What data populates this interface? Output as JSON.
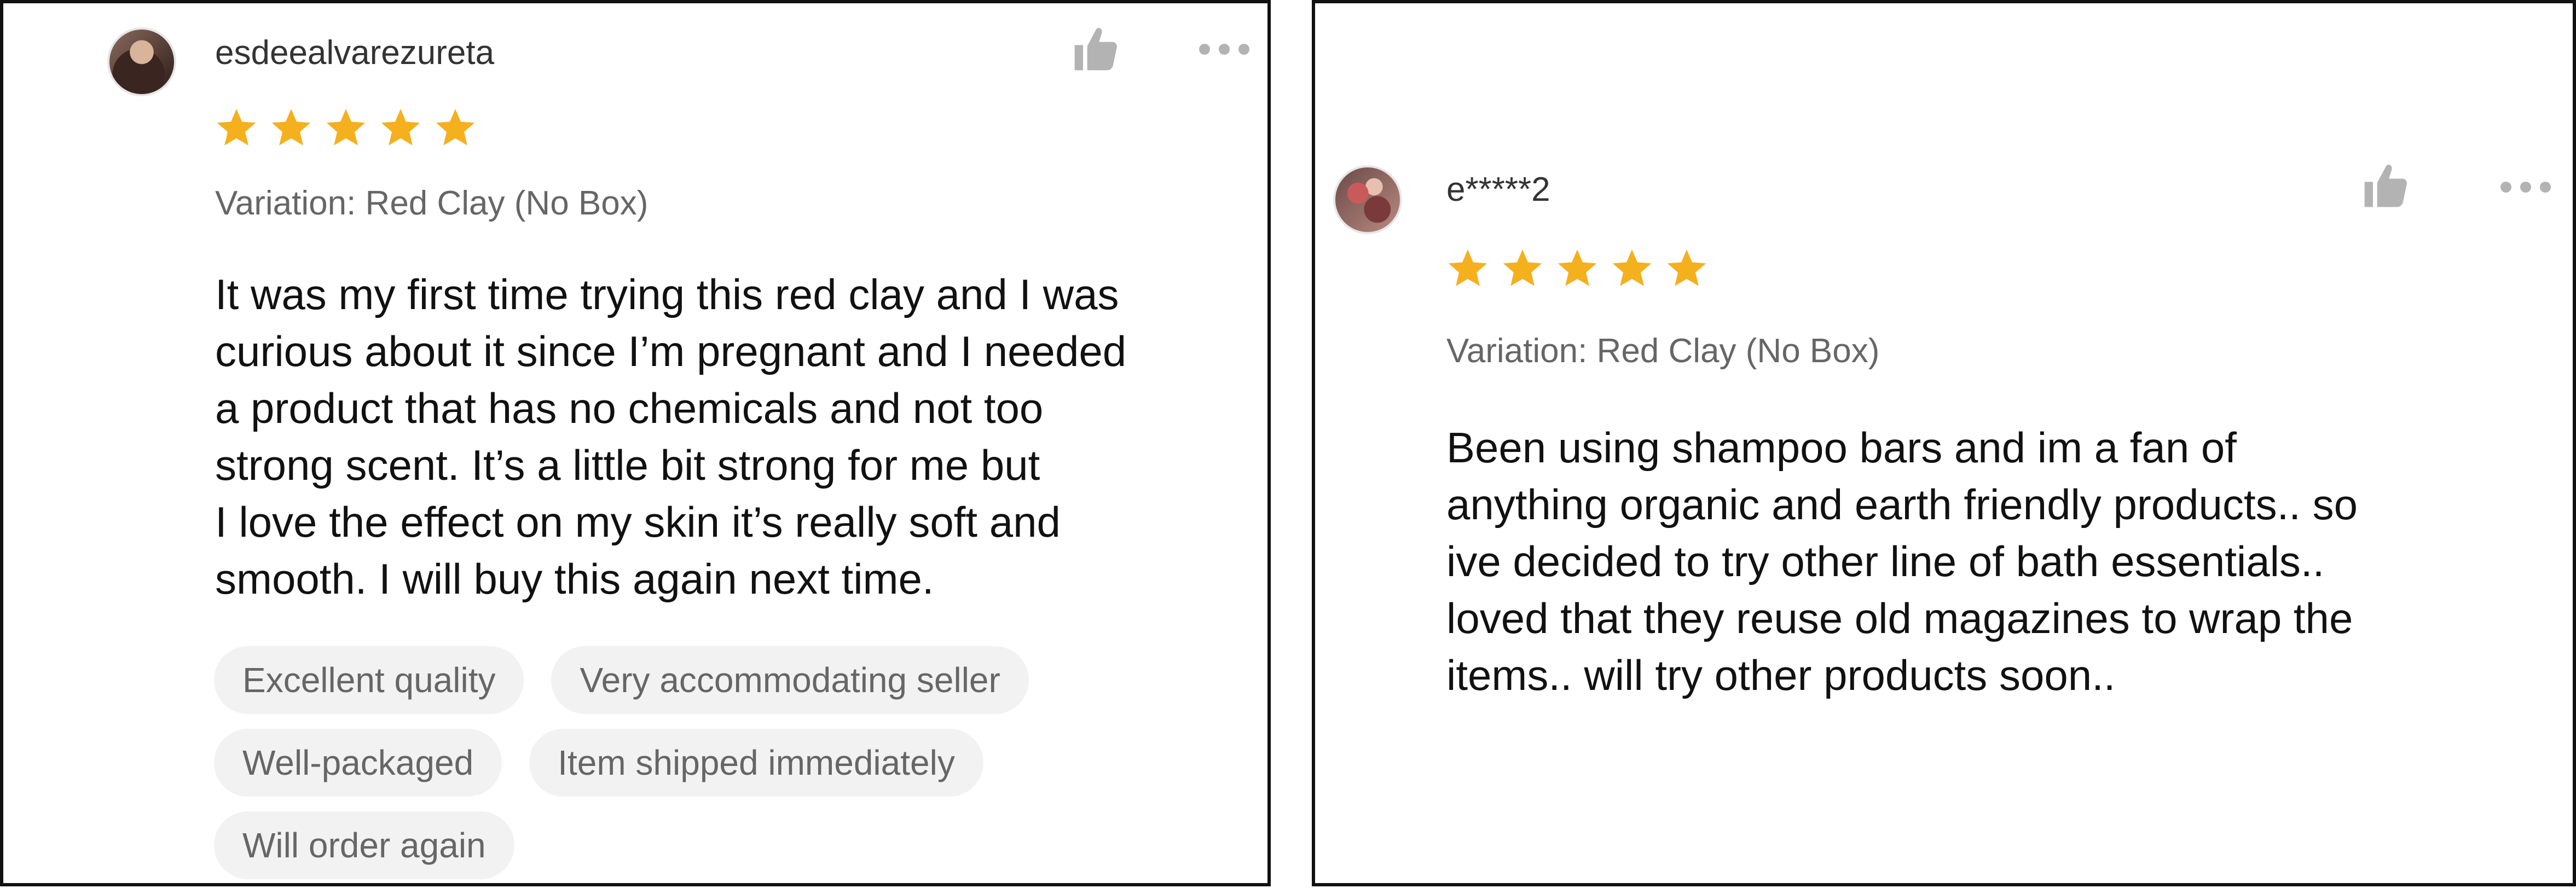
{
  "reviews": [
    {
      "username": "esdeealvarezureta",
      "rating": 5,
      "variation": "Variation: Red Clay (No Box)",
      "text_lines": [
        "It was my first time trying this red clay and I was",
        "curious about it since I’m pregnant and I needed",
        "a product that has no chemicals and not too",
        "strong scent. It’s a little bit strong for me but",
        "I love the effect on my skin it’s really soft and",
        "smooth. I will buy this again next time."
      ],
      "tags": [
        [
          "Excellent quality",
          "Very accommodating seller"
        ],
        [
          "Well-packaged",
          "Item shipped immediately"
        ],
        [
          "Will order again"
        ]
      ]
    },
    {
      "username": "e*****2",
      "rating": 5,
      "variation": "Variation: Red Clay (No Box)",
      "text_lines": [
        "Been using shampoo bars and im a fan of",
        "anything organic and earth friendly products.. so",
        "ive decided to try other line of bath essentials..",
        "loved that they reuse old magazines to wrap the",
        "items.. will try other products soon.."
      ]
    }
  ],
  "icons": {
    "avatar": "user-avatar",
    "star": "star-icon",
    "like": "thumbs-up-icon",
    "more": "more-options-icon"
  },
  "colors": {
    "star": "#F5B01E",
    "icon_gray": "#B3B3B3",
    "tag_background": "#F2F2F2"
  }
}
